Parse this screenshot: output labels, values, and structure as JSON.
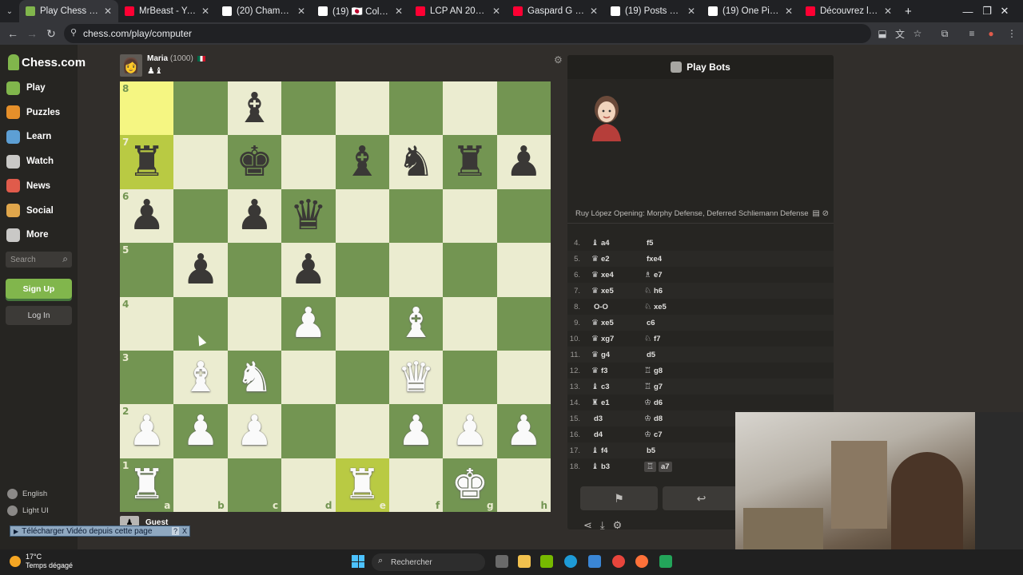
{
  "browser": {
    "tabs": [
      {
        "title": "Play Chess Online Ag",
        "color": "#81b64c",
        "active": true
      },
      {
        "title": "MrBeast - YouTube",
        "color": "#ff0033",
        "active": false
      },
      {
        "title": "(20) Champagne Josh",
        "color": "#ffffff",
        "active": false
      },
      {
        "title": "(19) 🇯🇵 Colonel Otaku",
        "color": "#ffffff",
        "active": false
      },
      {
        "title": "LCP AN 2018 04 22 2",
        "color": "#ff0033",
        "active": false
      },
      {
        "title": "Gaspard G - YouTube",
        "color": "#ff0033",
        "active": false
      },
      {
        "title": "(19) Posts avec répon",
        "color": "#ffffff",
        "active": false
      },
      {
        "title": "(19) One Piece Spoile",
        "color": "#ffffff",
        "active": false
      },
      {
        "title": "Découvrez la randon",
        "color": "#ff0033",
        "active": false
      }
    ],
    "new_tab": "+",
    "url": "chess.com/play/computer"
  },
  "sidebar": {
    "logo_text": "Chess.com",
    "items": [
      {
        "label": "Play",
        "icon": "play-icon",
        "color": "#81b64c"
      },
      {
        "label": "Puzzles",
        "icon": "puzzle-icon",
        "color": "#e58f2a"
      },
      {
        "label": "Learn",
        "icon": "learn-icon",
        "color": "#5d9fd4"
      },
      {
        "label": "Watch",
        "icon": "watch-icon",
        "color": "#c9c8c6"
      },
      {
        "label": "News",
        "icon": "news-icon",
        "color": "#e05b4b"
      },
      {
        "label": "Social",
        "icon": "social-icon",
        "color": "#e0a64b"
      },
      {
        "label": "More",
        "icon": "more-icon",
        "color": "#c9c8c6"
      }
    ],
    "search_placeholder": "Search",
    "signup": "Sign Up",
    "login": "Log In",
    "language": "English",
    "theme": "Light UI"
  },
  "game": {
    "top_player": {
      "name": "Maria",
      "rating": "(1000)",
      "captured": "♟♝"
    },
    "bottom_player": {
      "name": "Guest"
    },
    "board": [
      [
        "",
        "",
        "b",
        "",
        "",
        "",
        "",
        ""
      ],
      [
        "r",
        "",
        "k",
        "",
        "b",
        "n",
        "r",
        "p"
      ],
      [
        "p",
        "",
        "p",
        "q",
        "",
        "",
        "",
        ""
      ],
      [
        "",
        "p",
        "",
        "p",
        "",
        "",
        "",
        ""
      ],
      [
        "",
        "",
        "",
        "P",
        "",
        "B",
        "",
        ""
      ],
      [
        "",
        "B",
        "N",
        "",
        "",
        "Q",
        "",
        ""
      ],
      [
        "P",
        "P",
        "P",
        "",
        "",
        "P",
        "P",
        "P"
      ],
      [
        "R",
        "",
        "",
        "",
        "R",
        "",
        "K",
        ""
      ]
    ],
    "highlights": [
      "a8",
      "a7",
      "e1"
    ],
    "ranks": [
      "8",
      "7",
      "6",
      "5",
      "4",
      "3",
      "2",
      "1"
    ],
    "files": [
      "a",
      "b",
      "c",
      "d",
      "e",
      "f",
      "g",
      "h"
    ]
  },
  "panel": {
    "title": "Play Bots",
    "opening": "Ruy López Opening: Morphy Defense, Deferred Schliemann Defense",
    "moves": [
      {
        "n": "4.",
        "w_icon": "♝",
        "w": "a4",
        "b_icon": "",
        "b": "f5"
      },
      {
        "n": "5.",
        "w_icon": "♛",
        "w": "e2",
        "b_icon": "",
        "b": "fxe4"
      },
      {
        "n": "6.",
        "w_icon": "♛",
        "w": "xe4",
        "b_icon": "♗",
        "b": "e7"
      },
      {
        "n": "7.",
        "w_icon": "♛",
        "w": "xe5",
        "b_icon": "♘",
        "b": "h6"
      },
      {
        "n": "8.",
        "w_icon": "",
        "w": "O-O",
        "b_icon": "♘",
        "b": "xe5"
      },
      {
        "n": "9.",
        "w_icon": "♛",
        "w": "xe5",
        "b_icon": "",
        "b": "c6"
      },
      {
        "n": "10.",
        "w_icon": "♛",
        "w": "xg7",
        "b_icon": "♘",
        "b": "f7"
      },
      {
        "n": "11.",
        "w_icon": "♛",
        "w": "g4",
        "b_icon": "",
        "b": "d5"
      },
      {
        "n": "12.",
        "w_icon": "♛",
        "w": "f3",
        "b_icon": "♖",
        "b": "g8"
      },
      {
        "n": "13.",
        "w_icon": "♝",
        "w": "c3",
        "b_icon": "♖",
        "b": "g7"
      },
      {
        "n": "14.",
        "w_icon": "♜",
        "w": "e1",
        "b_icon": "♔",
        "b": "d6"
      },
      {
        "n": "15.",
        "w_icon": "",
        "w": "d3",
        "b_icon": "♔",
        "b": "d8"
      },
      {
        "n": "16.",
        "w_icon": "",
        "w": "d4",
        "b_icon": "♔",
        "b": "c7"
      },
      {
        "n": "17.",
        "w_icon": "♝",
        "w": "f4",
        "b_icon": "",
        "b": "b5"
      },
      {
        "n": "18.",
        "w_icon": "♝",
        "w": "b3",
        "b_icon": "♖",
        "b": "a7"
      }
    ]
  },
  "overlay": {
    "download_text": "Télécharger Vidéo depuis cette page",
    "help": "?",
    "close": "X"
  },
  "taskbar": {
    "temp": "17°C",
    "weather": "Temps dégagé",
    "search": "Rechercher"
  }
}
